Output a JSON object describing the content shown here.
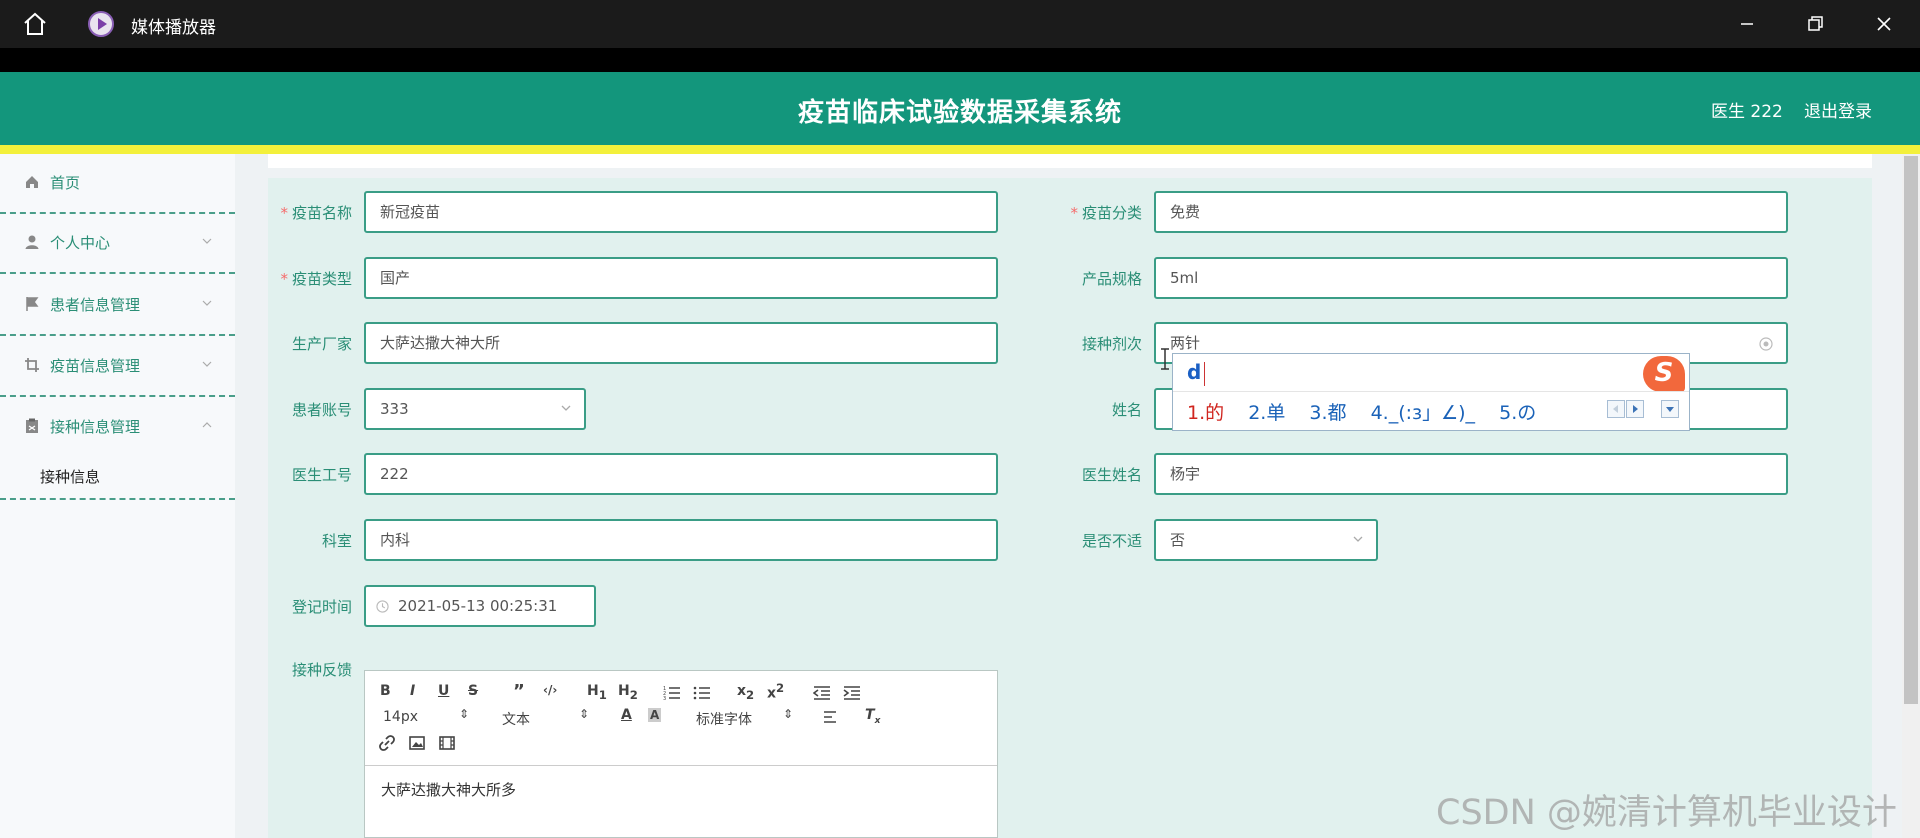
{
  "window": {
    "title": "媒体播放器"
  },
  "header": {
    "title": "疫苗临床试验数据采集系统",
    "user": "医生 222",
    "logout": "退出登录"
  },
  "sidebar": {
    "items": [
      {
        "label": "首页"
      },
      {
        "label": "个人中心"
      },
      {
        "label": "患者信息管理"
      },
      {
        "label": "疫苗信息管理"
      },
      {
        "label": "接种信息管理"
      }
    ],
    "subitem": "接种信息"
  },
  "form": {
    "vaccine_name": {
      "label": "疫苗名称",
      "value": "新冠疫苗",
      "required": true
    },
    "vaccine_category": {
      "label": "疫苗分类",
      "value": "免费",
      "required": true
    },
    "vaccine_type": {
      "label": "疫苗类型",
      "value": "国产",
      "required": true
    },
    "product_spec": {
      "label": "产品规格",
      "value": "5ml"
    },
    "manufacturer": {
      "label": "生产厂家",
      "value": "大萨达撒大神大所"
    },
    "dose_count": {
      "label": "接种剂次",
      "value": "两针"
    },
    "patient_account": {
      "label": "患者账号",
      "value": "333"
    },
    "name": {
      "label": "姓名",
      "value": ""
    },
    "doctor_id": {
      "label": "医生工号",
      "value": "222"
    },
    "doctor_name": {
      "label": "医生姓名",
      "value": "杨宇"
    },
    "department": {
      "label": "科室",
      "value": "内科"
    },
    "discomfort": {
      "label": "是否不适",
      "value": "否"
    },
    "register_time": {
      "label": "登记时间",
      "value": "2021-05-13 00:25:31"
    },
    "feedback": {
      "label": "接种反馈",
      "value": "大萨达撒大神大所多"
    }
  },
  "editor": {
    "font_size": "14px",
    "text_style": "文本",
    "font_family": "标准字体"
  },
  "ime": {
    "composition": "d",
    "candidates": [
      "1.的",
      "2.单",
      "3.都",
      "4._(:з」∠)_",
      "5.の"
    ],
    "logo": "S"
  },
  "watermark": "CSDN @婉清计算机毕业设计",
  "colors": {
    "header": "#13967c",
    "accent": "#2a8e76",
    "yellow": "#f3f03b",
    "required": "#f56c6c"
  }
}
